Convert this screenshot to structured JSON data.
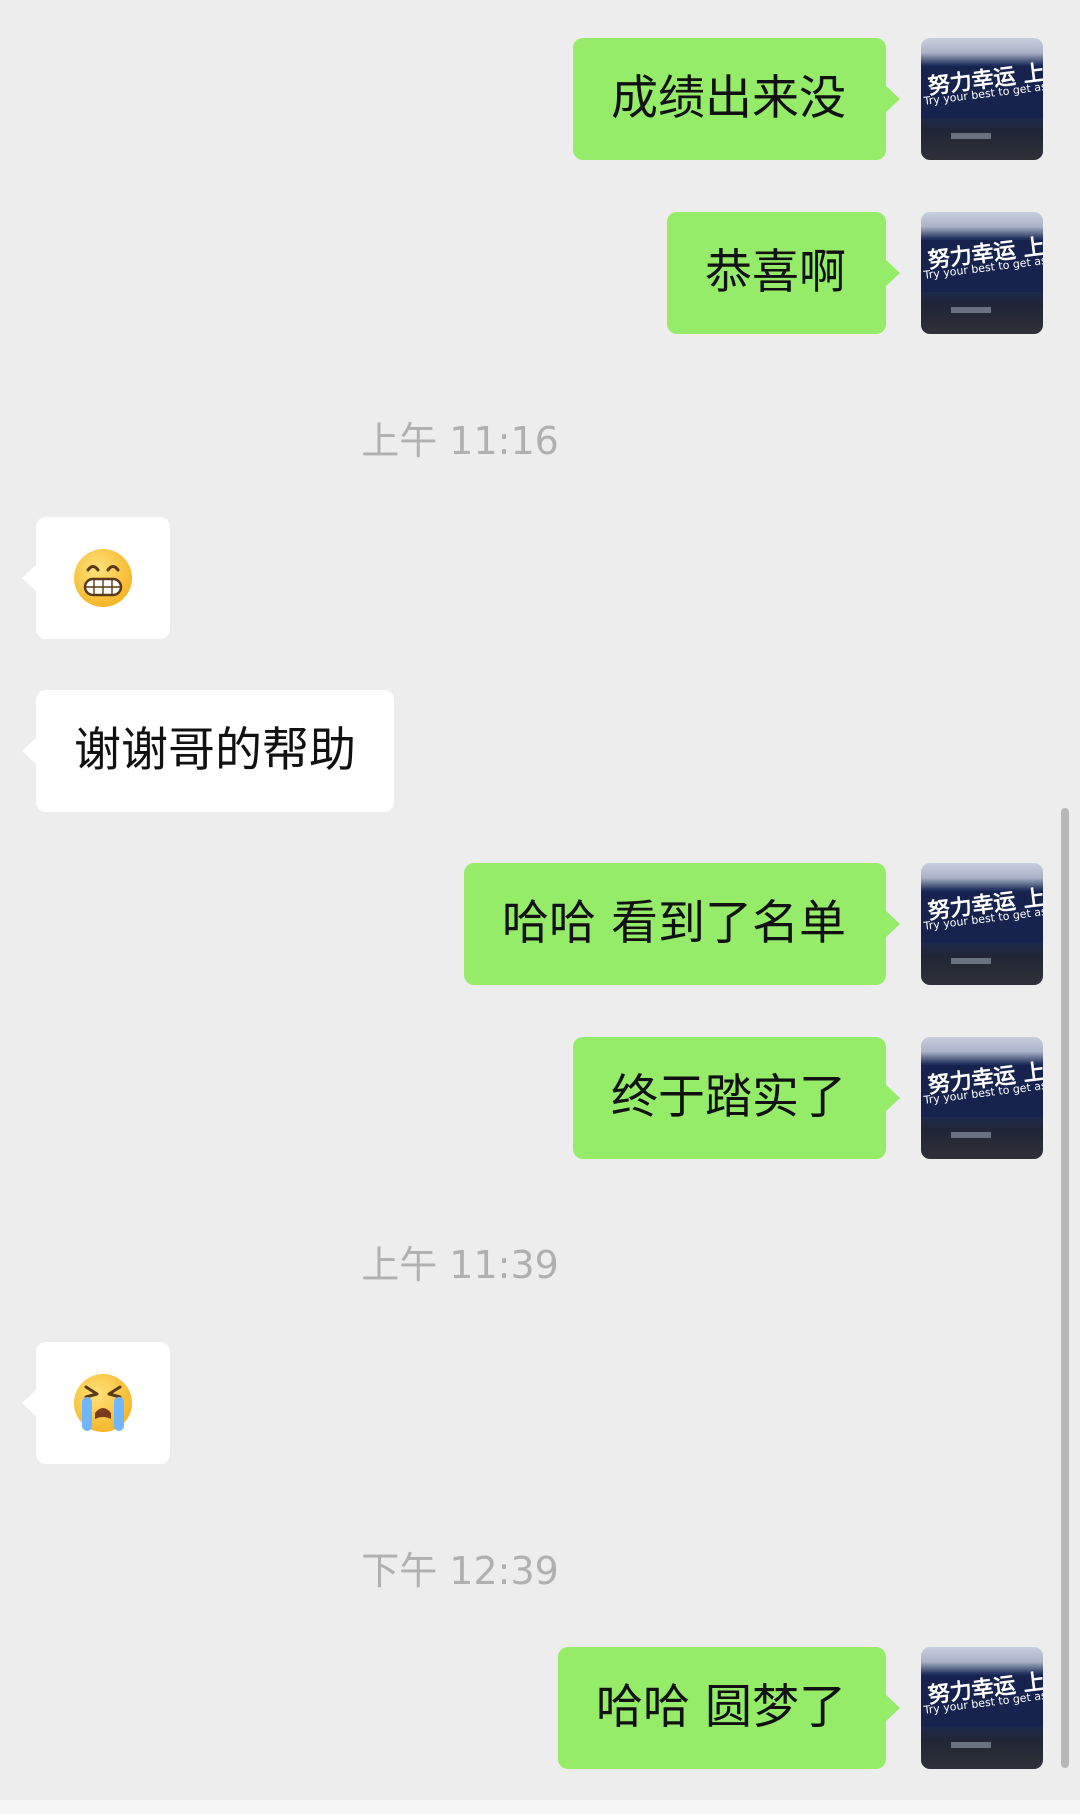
{
  "conversation": {
    "messages": [
      {
        "kind": "message",
        "side": "sent",
        "text": "成绩出来没"
      },
      {
        "kind": "message",
        "side": "sent",
        "text": "恭喜啊"
      },
      {
        "kind": "timestamp",
        "text": "上午 11:16"
      },
      {
        "kind": "message",
        "side": "received",
        "emoji": "grinning-face-icon"
      },
      {
        "kind": "message",
        "side": "received",
        "text": "谢谢哥的帮助"
      },
      {
        "kind": "message",
        "side": "sent",
        "text": "哈哈 看到了名单"
      },
      {
        "kind": "message",
        "side": "sent",
        "text": "终于踏实了"
      },
      {
        "kind": "timestamp",
        "text": "上午 11:39"
      },
      {
        "kind": "message",
        "side": "received",
        "emoji": "loudly-crying-face-icon"
      },
      {
        "kind": "timestamp",
        "text": "下午 12:39"
      },
      {
        "kind": "message",
        "side": "sent",
        "text": "哈哈 圆梦了"
      }
    ]
  },
  "avatar": {
    "sign_text_cn": "努力幸运 上岸",
    "sign_text_en": "Try your best to get ashore"
  },
  "colors": {
    "background": "#ededed",
    "sent_bubble": "#95ec69",
    "received_bubble": "#ffffff",
    "timestamp_text": "#b0b0b0"
  }
}
